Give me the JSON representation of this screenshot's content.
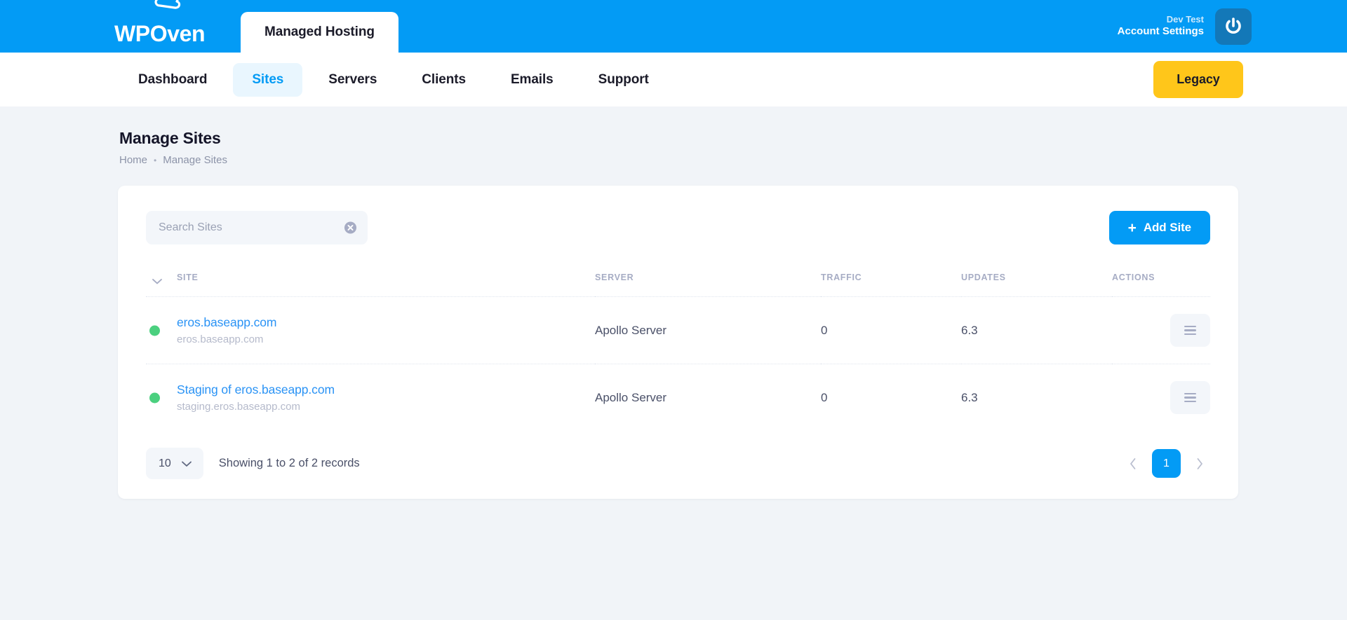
{
  "topbar": {
    "brand_text": "WPOven",
    "brand_icon": "cloud-icon",
    "tab_label": "Managed Hosting",
    "account_name": "Dev Test",
    "account_settings_label": "Account Settings",
    "avatar_icon": "power-gravatar-icon",
    "bg_color": "#039BF5"
  },
  "nav": {
    "items": [
      {
        "label": "Dashboard",
        "active": false
      },
      {
        "label": "Sites",
        "active": true
      },
      {
        "label": "Servers",
        "active": false
      },
      {
        "label": "Clients",
        "active": false
      },
      {
        "label": "Emails",
        "active": false
      },
      {
        "label": "Support",
        "active": false
      }
    ],
    "legacy_label": "Legacy",
    "legacy_color": "#FFC61A",
    "active_color": "#039BF5"
  },
  "page": {
    "title": "Manage Sites",
    "breadcrumb": {
      "home": "Home",
      "separator": "•",
      "current": "Manage Sites"
    }
  },
  "toolbar": {
    "search_placeholder": "Search Sites",
    "search_value": "",
    "clear_icon": "close-circle-icon",
    "add_site_label": "Add Site",
    "add_site_plus": "+",
    "add_site_color": "#039BF5"
  },
  "table": {
    "sort_icon": "chevron-down-icon",
    "headers": {
      "site": "SITE",
      "server": "SERVER",
      "traffic": "TRAFFIC",
      "updates": "UPDATES",
      "actions": "ACTIONS"
    },
    "rows": [
      {
        "status": "online",
        "status_color": "#4BD07F",
        "name": "eros.baseapp.com",
        "domain": "eros.baseapp.com",
        "server": "Apollo Server",
        "traffic": "0",
        "updates": "6.3",
        "action_icon": "hamburger-menu-icon"
      },
      {
        "status": "online",
        "status_color": "#4BD07F",
        "name": "Staging of eros.baseapp.com",
        "domain": "staging.eros.baseapp.com",
        "server": "Apollo Server",
        "traffic": "0",
        "updates": "6.3",
        "action_icon": "hamburger-menu-icon"
      }
    ]
  },
  "footer": {
    "page_size": "10",
    "page_size_icon": "chevron-down-icon",
    "records_text": "Showing 1 to 2 of 2 records",
    "prev_icon": "chevron-left-icon",
    "next_icon": "chevron-right-icon",
    "current_page": "1"
  }
}
